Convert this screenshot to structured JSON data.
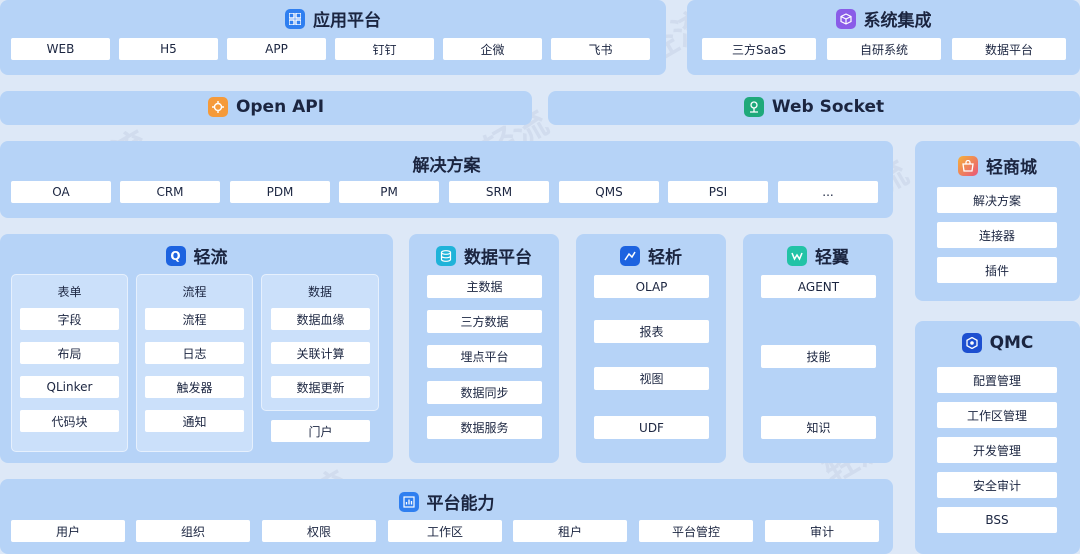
{
  "colors": {
    "panel": "#b6d3f7",
    "bg": "#dde8f7",
    "item": "#ffffff",
    "sub": "#cbe0fa",
    "text": "#1b2540"
  },
  "app_platform": {
    "title": "应用平台",
    "icon": "grid-icon",
    "items": [
      "WEB",
      "H5",
      "APP",
      "钉钉",
      "企微",
      "飞书"
    ]
  },
  "system_integration": {
    "title": "系统集成",
    "icon": "cube-icon",
    "items": [
      "三方SaaS",
      "自研系统",
      "数据平台"
    ]
  },
  "open_api": {
    "title": "Open API",
    "icon": "api-icon"
  },
  "web_socket": {
    "title": "Web Socket",
    "icon": "network-icon"
  },
  "solutions": {
    "title": "解决方案",
    "items": [
      "OA",
      "CRM",
      "PDM",
      "PM",
      "SRM",
      "QMS",
      "PSI",
      "..."
    ]
  },
  "qingshangcheng": {
    "title": "轻商城",
    "icon": "store-icon",
    "items": [
      "解决方案",
      "连接器",
      "插件"
    ]
  },
  "qingliu": {
    "title": "轻流",
    "icon": "qingliu-icon",
    "forms": {
      "title": "表单",
      "items": [
        "字段",
        "布局",
        "QLinker",
        "代码块"
      ]
    },
    "process": {
      "title": "流程",
      "items": [
        "流程",
        "日志",
        "触发器",
        "通知"
      ]
    },
    "data": {
      "title": "数据",
      "items": [
        "数据血缘",
        "关联计算",
        "数据更新"
      ]
    },
    "portal": "门户"
  },
  "data_platform": {
    "title": "数据平台",
    "icon": "database-icon",
    "items": [
      "主数据",
      "三方数据",
      "埋点平台",
      "数据同步",
      "数据服务"
    ]
  },
  "qingxi": {
    "title": "轻析",
    "icon": "qingxi-icon",
    "items": [
      "OLAP",
      "报表",
      "视图",
      "UDF"
    ]
  },
  "qingyi": {
    "title": "轻翼",
    "icon": "qingyi-icon",
    "items": [
      "AGENT",
      "技能",
      "知识"
    ]
  },
  "qmc": {
    "title": "QMC",
    "icon": "qmc-icon",
    "items": [
      "配置管理",
      "工作区管理",
      "开发管理",
      "安全审计",
      "BSS"
    ]
  },
  "platform_capability": {
    "title": "平台能力",
    "icon": "capability-icon",
    "items": [
      "用户",
      "组织",
      "权限",
      "工作区",
      "租户",
      "平台管控",
      "审计"
    ]
  },
  "watermark": "轻流"
}
